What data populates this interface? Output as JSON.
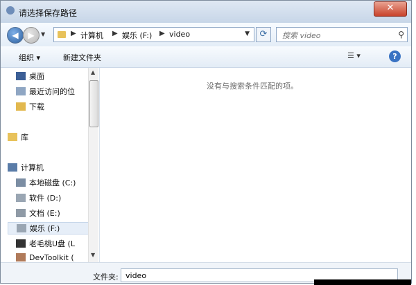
{
  "window": {
    "title": "请选择保存路径",
    "close_glyph": "✕"
  },
  "nav": {
    "back_glyph": "◀",
    "forward_glyph": "▶",
    "breadcrumb": [
      "计算机",
      "娱乐 (F:)",
      "video"
    ],
    "search_placeholder": "搜索 video"
  },
  "toolbar": {
    "organize_label": "组织 ▾",
    "new_folder_label": "新建文件夹"
  },
  "sidebar": {
    "items": [
      {
        "label": "桌面",
        "icon": "desktop-icon"
      },
      {
        "label": "最近访问的位",
        "icon": "recent-places-icon"
      },
      {
        "label": "下载",
        "icon": "downloads-icon"
      },
      {
        "label": "库",
        "icon": "library-icon"
      },
      {
        "label": "计算机",
        "icon": "computer-icon"
      },
      {
        "label": "本地磁盘 (C:)",
        "icon": "drive-icon"
      },
      {
        "label": "软件 (D:)",
        "icon": "drive-icon"
      },
      {
        "label": "文档 (E:)",
        "icon": "network-drive-icon"
      },
      {
        "label": "娱乐 (F:)",
        "icon": "drive-icon",
        "selected": true
      },
      {
        "label": "老毛桃U盘 (L",
        "icon": "usb-drive-icon"
      },
      {
        "label": "DevToolkit (",
        "icon": "disc-drive-icon"
      }
    ]
  },
  "content": {
    "empty_message": "没有与搜索条件匹配的项。"
  },
  "footer": {
    "filename_label": "文件夹:",
    "filename_value": "video"
  },
  "colors": {
    "accent": "#3a73c3",
    "title_bar": "#c7d6e8",
    "close_button": "#c8432c"
  }
}
